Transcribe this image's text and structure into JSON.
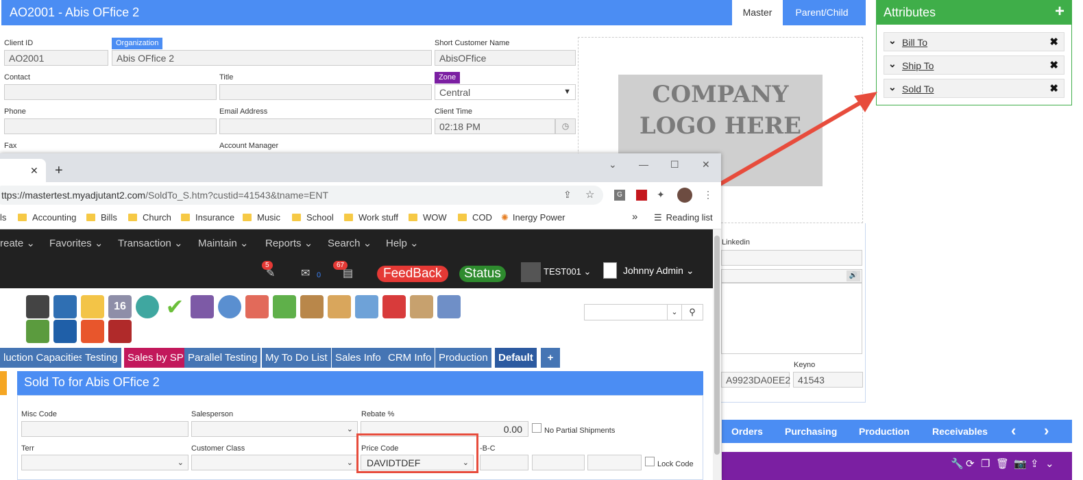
{
  "record": {
    "title": "AO2001 - Abis OFfice 2",
    "tabs": [
      "Master",
      "Parent/Child"
    ],
    "fields": {
      "client_id": {
        "label": "Client ID",
        "value": "AO2001"
      },
      "organization": {
        "label": "Organization",
        "value": "Abis OFfice 2"
      },
      "short_name": {
        "label": "Short Customer Name",
        "value": "AbisOFfice"
      },
      "contact": {
        "label": "Contact",
        "value": ""
      },
      "title": {
        "label": "Title",
        "value": ""
      },
      "zone": {
        "label": "Zone",
        "value": "Central"
      },
      "phone": {
        "label": "Phone",
        "value": ""
      },
      "email": {
        "label": "Email Address",
        "value": ""
      },
      "client_time": {
        "label": "Client Time",
        "value": "02:18 PM"
      },
      "fax": {
        "label": "Fax"
      },
      "account_manager": {
        "label": "Account Manager"
      },
      "linkedin": {
        "label": "Linkedin"
      },
      "guid_value": "A9923DA0EE2",
      "keyno": {
        "label": "Keyno",
        "value": "41543"
      }
    },
    "logo_text": "COMPANY LOGO HERE",
    "accent_color": "#4b8df3"
  },
  "attributes": {
    "title": "Attributes",
    "add": "+",
    "items": [
      "Bill To",
      "Ship To",
      "Sold To"
    ],
    "accent_color": "#3fae49"
  },
  "bottom_nav": {
    "items": [
      "Orders",
      "Purchasing",
      "Production",
      "Receivables"
    ],
    "prev": "‹",
    "next": "›"
  },
  "browser": {
    "url_prefix": "ttps://mastertest.myadjutant2.com",
    "url_path": "/SoldTo_S.htm?custid=41543&tname=ENT",
    "bookmarks": [
      "ls",
      "Accounting",
      "Bills",
      "Church",
      "Insurance",
      "Music",
      "School",
      "Work stuff",
      "WOW",
      "COD",
      "Inergy Power"
    ],
    "reading_list": "Reading list",
    "overflow": "»"
  },
  "site": {
    "menu": [
      "reate",
      "Favorites",
      "Transaction",
      "Maintain",
      "Reports",
      "Search",
      "Help"
    ],
    "notifications": {
      "tasks": "5",
      "mail": "0",
      "alerts": "67"
    },
    "feedback": "FeedBack",
    "status": "Status",
    "company": "TEST001",
    "user": "Johnny Admin",
    "tabs": [
      "luction Capacities",
      "Testing",
      "Sales by SP",
      "Parallel Testing",
      "My To Do List",
      "Sales Info",
      "CRM Info",
      "Production",
      "Default",
      "+"
    ],
    "sold_to": {
      "title": "Sold To for Abis OFfice 2",
      "misc_code": {
        "label": "Misc Code",
        "value": ""
      },
      "salesperson": {
        "label": "Salesperson",
        "value": ""
      },
      "rebate": {
        "label": "Rebate %",
        "value": "0.00"
      },
      "no_partial": "No Partial Shipments",
      "terr": {
        "label": "Terr",
        "value": ""
      },
      "customer_class": {
        "label": "Customer Class",
        "value": ""
      },
      "price_code": {
        "label": "Price Code",
        "value": "DAVIDTDEF"
      },
      "abc": {
        "label": "-B-C"
      },
      "lock_code": "Lock Code"
    }
  }
}
